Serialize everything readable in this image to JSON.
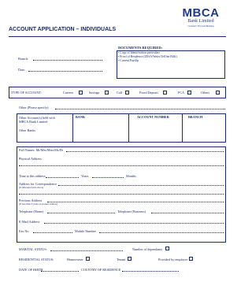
{
  "logo": {
    "brand": "MBCA",
    "name": "Bank Limited",
    "tagline": "Customer Focused Banking"
  },
  "form": {
    "title": "ACCOUNT APPLICATION – INDIVIDUALS",
    "branch_label": "Branch:",
    "date_label": "Date:",
    "documents": {
      "title": "DOCUMENTS REQUIRED:",
      "items": [
        "Copy of Identification particulars",
        "Proof of Residence (ZESA/Water/TelOne Bills)",
        "Current Payslip"
      ]
    },
    "account_type": {
      "label": "TYPE OF ACCOUNT:",
      "options": [
        "Current",
        "Savings",
        "Call",
        "Fixed Deposit",
        "FCA",
        "Others"
      ]
    },
    "other_label": "Other (Please specify):",
    "other_accounts": {
      "label_line1": "Other Account(s) held with",
      "label_line2": "MBCA Bank Limited",
      "other_banks": "Other Banks",
      "col_bank": "BANK",
      "col_account": "ACCOUNT NUMBER",
      "col_branch": "BRANCH"
    },
    "personal": {
      "full_names": "Full Names: Mr/Mrs/Miss/Ms/Dr",
      "physical_address": "Physical Address",
      "time_at_address": "Time at this address",
      "years": "Years",
      "months": "Months",
      "correspondence": "Address for Correspondence",
      "correspondence_note": "(if different from above)",
      "previous_address": "Previous Address",
      "previous_note": "(if less than 3 years at present address)",
      "tel_home": "Telephone (Home)",
      "tel_business": "Telephone (Business)",
      "email": "E-Mail Address",
      "fax": "Fax No",
      "mobile": "Mobile Number"
    },
    "marital_status": "MARITAL STATUS:",
    "dependants": "Number of dependants",
    "residential": {
      "label": "RESIDENTIAL STATUS:",
      "options": [
        "Homeowner",
        "Tenant",
        "Provided by employer"
      ]
    },
    "dob": "DATE OF BIRTH",
    "country": "COUNTRY OF RESIDENCE"
  }
}
